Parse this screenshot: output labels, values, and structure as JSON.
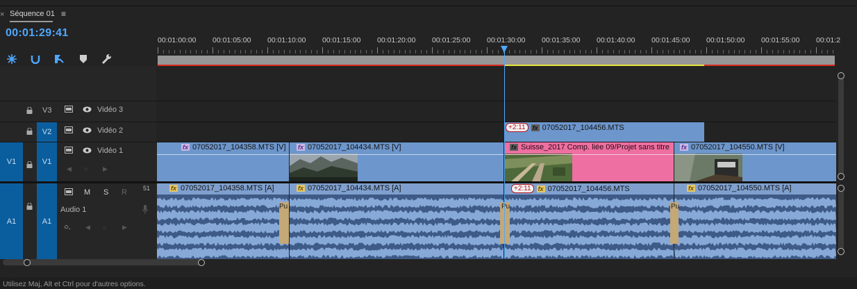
{
  "sequence": {
    "title": "Séquence 01",
    "timecode": "00:01:29:41"
  },
  "tab": {
    "close": "×",
    "menu": "≡"
  },
  "tools": [
    {
      "name": "snap-icon"
    },
    {
      "name": "linked-selection-icon"
    },
    {
      "name": "add-marker-icon"
    },
    {
      "name": "marker-icon"
    },
    {
      "name": "wrench-icon"
    }
  ],
  "ruler": {
    "labels": [
      "00:01:00:00",
      "00:01:05:00",
      "00:01:10:00",
      "00:01:15:00",
      "00:01:20:00",
      "00:01:25:00",
      "00:01:30:00",
      "00:01:35:00",
      "00:01:40:00",
      "00:01:45:00",
      "00:01:50:00",
      "00:01:55:00",
      "00:01:2"
    ]
  },
  "tracks": {
    "v3": {
      "label": "V3",
      "name": "Vidéo 3"
    },
    "v2": {
      "label": "V2",
      "name": "Vidéo 2"
    },
    "v1": {
      "source": "V1",
      "label": "V1",
      "name": "Vidéo 1"
    },
    "a1": {
      "source": "A1",
      "label": "A1",
      "name": "Audio 1",
      "mute": "M",
      "solo": "S",
      "record": "R",
      "volume": "51"
    }
  },
  "clips": {
    "v2_1": {
      "name": "07052017_104456.MTS",
      "badge": "+2:11"
    },
    "v1_1": {
      "name": "07052017_104358.MTS [V]"
    },
    "v1_2": {
      "name": "07052017_104434.MTS [V]"
    },
    "v1_3": {
      "name": "Suisse_2017 Comp. liée 09/Projet sans titre"
    },
    "v1_4": {
      "name": "07052017_104550.MTS [V]"
    },
    "a1_1": {
      "name": "07052017_104358.MTS [A]"
    },
    "a1_2": {
      "name": "07052017_104434.MTS [A]"
    },
    "a1_3": {
      "name": "07052017_104456.MTS",
      "badge": "+2:11"
    },
    "a1_4": {
      "name": "07052017_104550.MTS [A]"
    },
    "transition_label": "Pu"
  },
  "status": "Utilisez Maj, Alt et Ctrl pour d'autres options.",
  "colors": {
    "accent": "#4ea8ff",
    "video_clip": "#6d96cc",
    "nested_clip": "#ee6fa1",
    "track_target": "#0b5e9e",
    "work_area_line": "#d82a1e"
  }
}
